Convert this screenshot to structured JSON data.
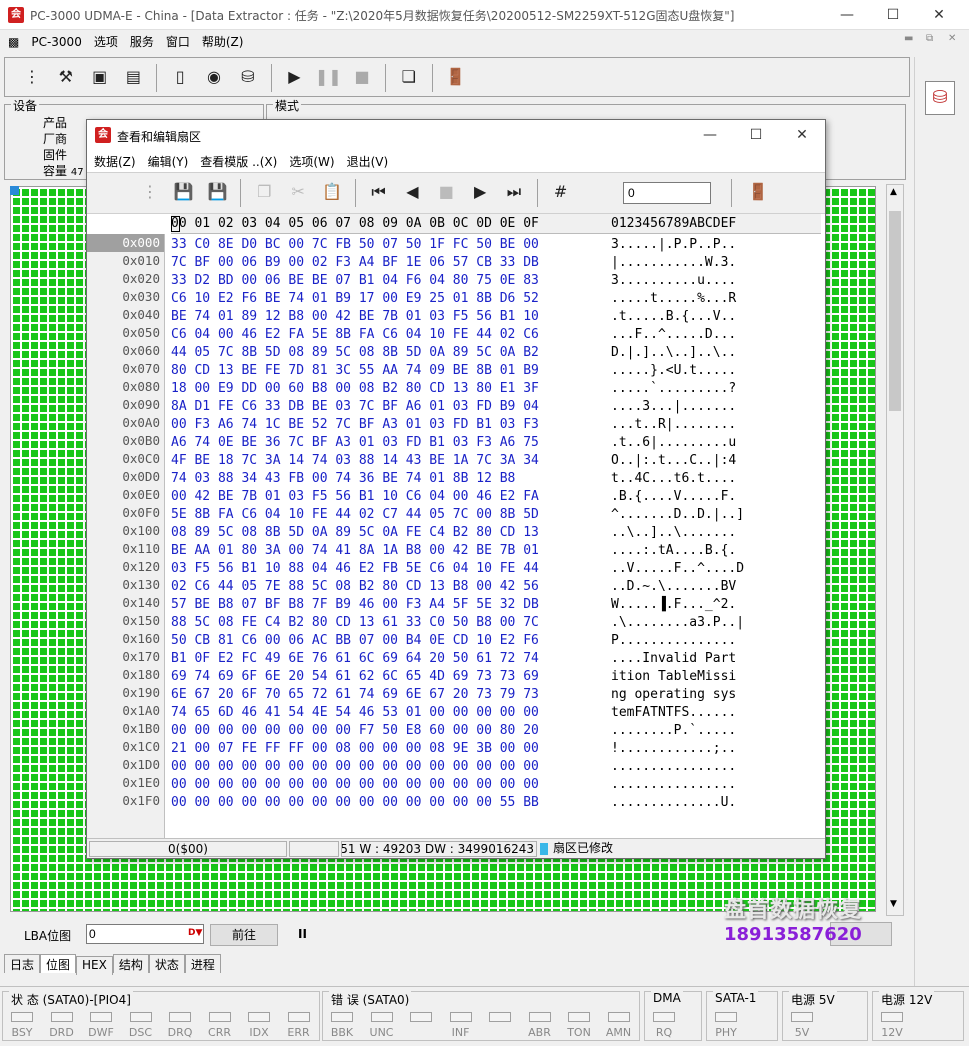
{
  "app": {
    "title": "PC-3000 UDMA-E - China - [Data Extractor : 任务 - \"Z:\\2020年5月数据恢复任务\\20200512-SM2259XT-512G固态U盘恢复\"]",
    "menu": [
      "PC-3000",
      "选项",
      "服务",
      "窗口",
      "帮助(Z)"
    ]
  },
  "device_group": {
    "title": "设备",
    "labels": [
      "产品",
      "厂商",
      "固件",
      "容量"
    ],
    "capacity_partial": "47"
  },
  "mode_group": {
    "title": "模式"
  },
  "dialog": {
    "title": "查看和编辑扇区",
    "menu": [
      "数据(Z)",
      "编辑(Y)",
      "查看模版 ..(X)",
      "选项(W)",
      "退出(V)"
    ],
    "goto_value": "0",
    "header_hex": "00 01 02 03 04 05 06 07 08 09 0A 0B 0C 0D 0E 0F",
    "header_ascii": "0123456789ABCDEF",
    "offsets": [
      "0x000",
      "0x010",
      "0x020",
      "0x030",
      "0x040",
      "0x050",
      "0x060",
      "0x070",
      "0x080",
      "0x090",
      "0x0A0",
      "0x0B0",
      "0x0C0",
      "0x0D0",
      "0x0E0",
      "0x0F0",
      "0x100",
      "0x110",
      "0x120",
      "0x130",
      "0x140",
      "0x150",
      "0x160",
      "0x170",
      "0x180",
      "0x190",
      "0x1A0",
      "0x1B0",
      "0x1C0",
      "0x1D0",
      "0x1E0",
      "0x1F0"
    ],
    "hex_rows": [
      "33 C0 8E D0 BC 00 7C FB 50 07 50 1F FC 50 BE 00",
      "7C BF 00 06 B9 00 02 F3 A4 BF 1E 06 57 CB 33 DB",
      "33 D2 BD 00 06 BE BE 07 B1 04 F6 04 80 75 0E 83",
      "C6 10 E2 F6 BE 74 01 B9 17 00 E9 25 01 8B D6 52",
      "BE 74 01 89 12 B8 00 42 BE 7B 01 03 F5 56 B1 10",
      "C6 04 00 46 E2 FA 5E 8B FA C6 04 10 FE 44 02 C6",
      "44 05 7C 8B 5D 08 89 5C 08 8B 5D 0A 89 5C 0A B2",
      "80 CD 13 BE FE 7D 81 3C 55 AA 74 09 BE 8B 01 B9",
      "18 00 E9 DD 00 60 B8 00 08 B2 80 CD 13 80 E1 3F",
      "8A D1 FE C6 33 DB BE 03 7C BF A6 01 03 FD B9 04",
      "00 F3 A6 74 1C BE 52 7C BF A3 01 03 FD B1 03 F3",
      "A6 74 0E BE 36 7C BF A3 01 03 FD B1 03 F3 A6 75",
      "4F BE 18 7C 3A 14 74 03 88 14 43 BE 1A 7C 3A 34",
      "74 03 88 34 43 FB 00 74 36 BE 74 01 8B 12 B8",
      "00 42 BE 7B 01 03 F5 56 B1 10 C6 04 00 46 E2 FA",
      "5E 8B FA C6 04 10 FE 44 02 C7 44 05 7C 00 8B 5D",
      "08 89 5C 08 8B 5D 0A 89 5C 0A FE C4 B2 80 CD 13",
      "BE AA 01 80 3A 00 74 41 8A 1A B8 00 42 BE 7B 01",
      "03 F5 56 B1 10 88 04 46 E2 FB 5E C6 04 10 FE 44",
      "02 C6 44 05 7E 88 5C 08 B2 80 CD 13 B8 00 42 56",
      "57 BE B8 07 BF B8 7F B9 46 00 F3 A4 5F 5E 32 DB",
      "88 5C 08 FE C4 B2 80 CD 13 61 33 C0 50 B8 00 7C",
      "50 CB 81 C6 00 06 AC BB 07 00 B4 0E CD 10 E2 F6",
      "B1 0F E2 FC 49 6E 76 61 6C 69 64 20 50 61 72 74",
      "69 74 69 6F 6E 20 54 61 62 6C 65 4D 69 73 73 69",
      "6E 67 20 6F 70 65 72 61 74 69 6E 67 20 73 79 73",
      "74 65 6D 46 41 54 4E 54 46 53 01 00 00 00 00 00",
      "00 00 00 00 00 00 00 00 F7 50 E8 60 00 00 80 20",
      "21 00 07 FE FF FF 00 08 00 00 00 08 9E 3B 00 00",
      "00 00 00 00 00 00 00 00 00 00 00 00 00 00 00 00",
      "00 00 00 00 00 00 00 00 00 00 00 00 00 00 00 00",
      "00 00 00 00 00 00 00 00 00 00 00 00 00 00 55 BB"
    ],
    "ascii_rows": [
      "3.....|.P.P..P..",
      "|...........W.3.",
      "3..........u....",
      ".....t.....%...R",
      ".t.....B.{...V..",
      "...F..^.....D...",
      "D.|.]..\\..]..\\..",
      ".....}.<U.t.....",
      ".....`.........?",
      "....3...|.......",
      "...t..R|........",
      ".t..6|.........u",
      "O..|:.t...C..|:4",
      "t..4C...t6.t....",
      ".B.{....V.....F.",
      "^.......D..D.|..]",
      "..\\..]..\\.......",
      "....:.tA....B.{.",
      "..V.....F..^....D",
      "..D.~.\\.......BV",
      "W.....▐.F..._^2.",
      ".\\........a3.P..|",
      "P...............",
      "....Invalid Part",
      "ition TableMissi",
      "ng operating sys",
      "temFATNTFS......",
      "........P.`.....",
      "!............;..",
      "................",
      "................",
      "..............U."
    ],
    "status": {
      "position": "0($00)",
      "info": "B : 51 W : 49203 DW : 3499016243",
      "modified": "扇区已修改"
    }
  },
  "lba": {
    "label": "LBA位图",
    "value": "0",
    "goto_label": "前往",
    "pause_label": "II"
  },
  "tabs": [
    "日志",
    "位图",
    "HEX",
    "结构",
    "状态",
    "进程"
  ],
  "statusbar": {
    "groups": [
      {
        "title": "状 态 (SATA0)-[PIO4]",
        "leds": [
          "BSY",
          "DRD",
          "DWF",
          "DSC",
          "DRQ",
          "CRR",
          "IDX",
          "ERR"
        ]
      },
      {
        "title": "错 误 (SATA0)",
        "leds": [
          "BBK",
          "UNC",
          "",
          "INF",
          "",
          "ABR",
          "TON",
          "AMN"
        ]
      },
      {
        "title": "DMA",
        "leds": [
          "RQ"
        ]
      },
      {
        "title": "SATA-1",
        "leds": [
          "PHY"
        ]
      },
      {
        "title": "电源 5V",
        "leds": [
          "5V"
        ]
      },
      {
        "title": "电源 12V",
        "leds": [
          "12V"
        ]
      }
    ]
  },
  "watermark": {
    "line1": "盘首数据恢复",
    "line2": "18913587620"
  },
  "colors": {
    "bitmap_green": "#19c619",
    "hex_blue": "#1a22c8",
    "watermark_purple": "#8a1fd8"
  }
}
